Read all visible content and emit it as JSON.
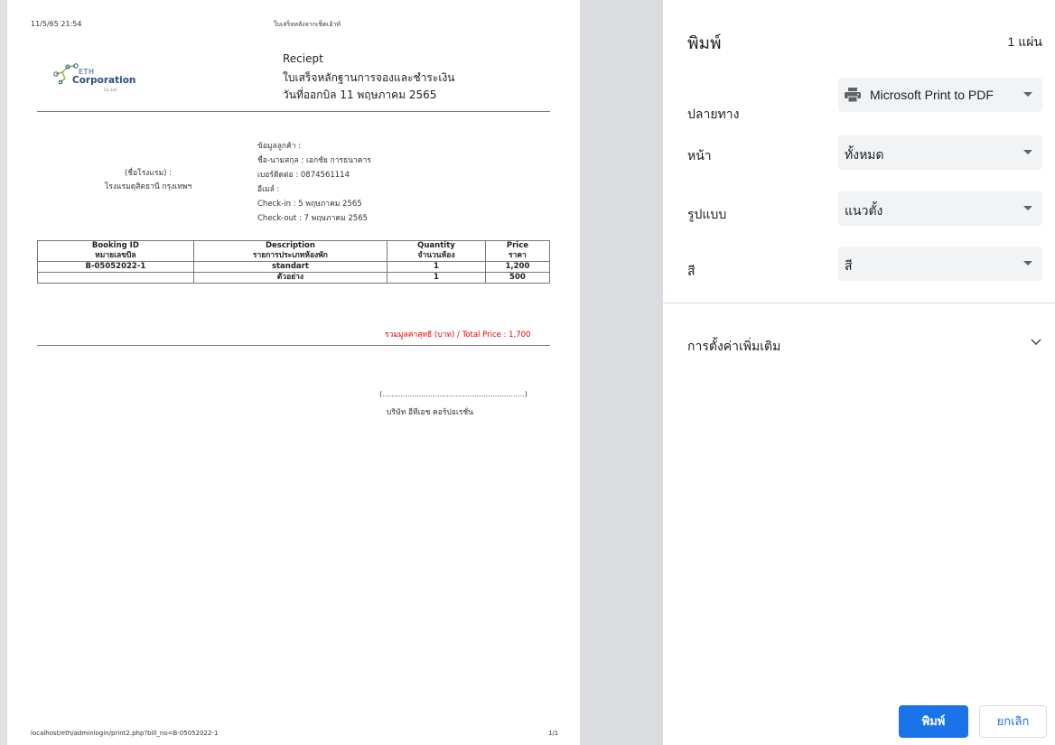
{
  "page_header": {
    "date": "11/5/65 21:54",
    "title": "ใบเสร็จหลังจากเช็คเอ้าท์"
  },
  "page_footer": {
    "url": "localhost/eth/adminlogin/print2.php?bill_no=B-05052022-1",
    "page_number": "1/1"
  },
  "logo": {
    "line1": "ETH",
    "line2": "Corporation",
    "line3": "Co.,Ltd."
  },
  "receipt": {
    "heading": "Reciept",
    "subtitle": "ใบเสร็จหลักฐานการจองและชำระเงิน",
    "issue_date": "วันที่ออกบิล 11 พฤษภาคม 2565"
  },
  "hotel": {
    "label": "(ชื่อโรงแรม) :",
    "name": "โรงแรมดุสิตธานี กรุงเทพฯ"
  },
  "customer": {
    "heading": "ข้อมูลลูกค้า :",
    "name": "ชื่อ-นามสกุล : เอกชัย การธนาคาร",
    "phone": "เบอร์ติดต่อ : 0874561114",
    "email": "อีเมล์ :",
    "checkin": "Check-in : 5 พฤษภาคม 2565",
    "checkout": "Check-out : 7 พฤษภาคม 2565"
  },
  "table": {
    "headers": [
      {
        "en": "Booking ID",
        "th": "หมายเลขบิล"
      },
      {
        "en": "Description",
        "th": "รายการประเภทห้องพัก"
      },
      {
        "en": "Quantity",
        "th": "จำนวนห้อง"
      },
      {
        "en": "Price",
        "th": "ราคา"
      }
    ],
    "rows": [
      [
        "B-05052022-1",
        "standart",
        "1",
        "1,200"
      ],
      [
        "",
        "ตัวอย่าง",
        "1",
        "500"
      ]
    ]
  },
  "total_line": "รวมมูลค่าสุทธิ (บาท) / Total Price : 1,700",
  "signature": {
    "line": "(..............................................................)",
    "company": "บริษัท อีทีเอช คอร์ปอเรชั่น"
  },
  "settings": {
    "title": "พิมพ์",
    "sheet_count": "1 แผ่น",
    "destination": {
      "label": "ปลายทาง",
      "value": "Microsoft Print to PDF",
      "icon": "printer-icon"
    },
    "pages": {
      "label": "หน้า",
      "value": "ทั้งหมด"
    },
    "layout": {
      "label": "รูปแบบ",
      "value": "แนวตั้ง"
    },
    "color": {
      "label": "สี",
      "value": "สี"
    },
    "more_settings": "การตั้งค่าเพิ่มเติม",
    "print_button": "พิมพ์",
    "cancel_button": "ยกเลิก",
    "accent_color": "#1a73e8"
  }
}
